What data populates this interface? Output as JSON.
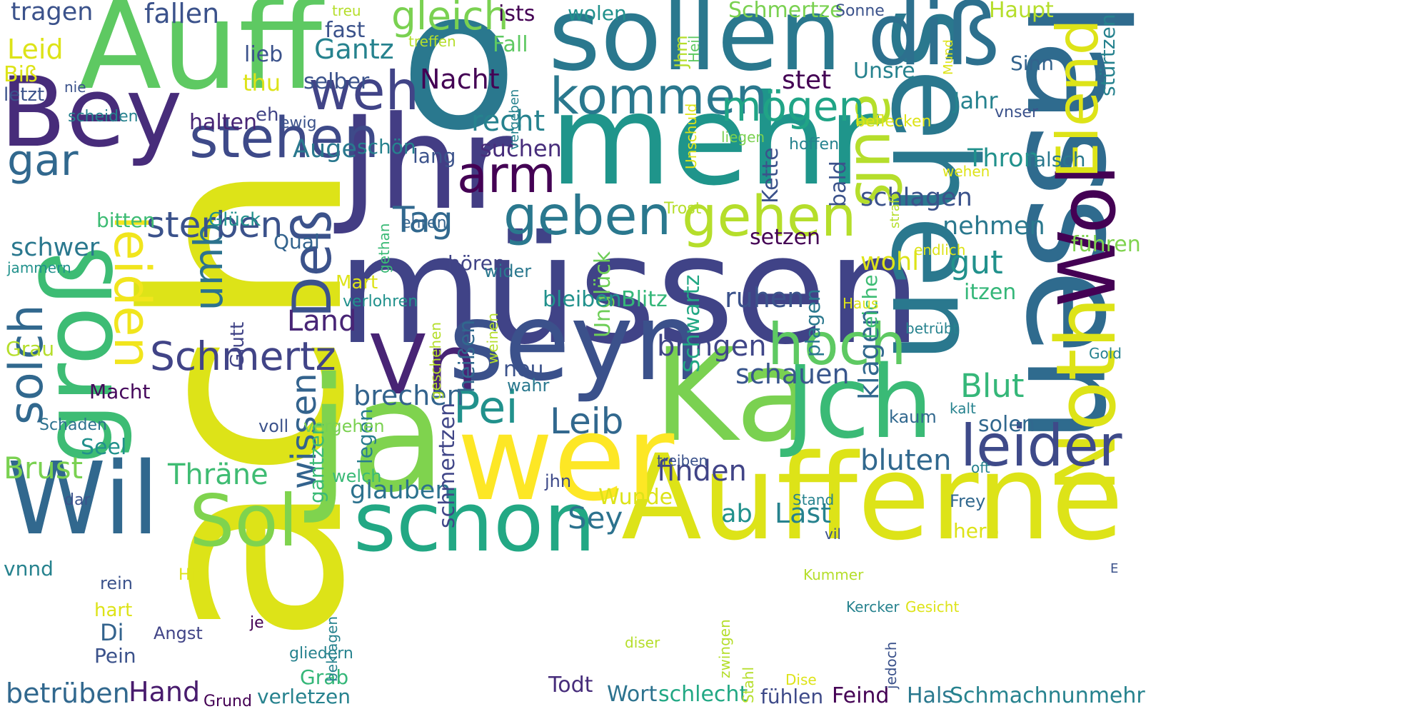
{
  "words": [
    {
      "text": "ach",
      "color": "#dde318"
    },
    {
      "text": "müssen",
      "color": "#404387"
    },
    {
      "text": "lassen",
      "color": "#2f6b8e"
    },
    {
      "text": "o",
      "color": "#2a788e"
    },
    {
      "text": "Jhr",
      "color": "#433d84"
    },
    {
      "text": "ja",
      "color": "#7fd34e"
    },
    {
      "text": "mehr",
      "color": "#1f958b"
    },
    {
      "text": "seyn",
      "color": "#3b518b"
    },
    {
      "text": "Auff",
      "color": "#5ec962"
    },
    {
      "text": "sehen",
      "color": "#2a788e"
    },
    {
      "text": "Ka",
      "color": "#7ad151"
    },
    {
      "text": "Aufferne",
      "color": "#dde318"
    },
    {
      "text": "wer",
      "color": "#fde725"
    },
    {
      "text": "sollen",
      "color": "#2a788e"
    },
    {
      "text": "groß",
      "color": "#3dbc74"
    },
    {
      "text": "Bey",
      "color": "#472c7a"
    },
    {
      "text": "Jch",
      "color": "#3aba76"
    },
    {
      "text": "Wil",
      "color": "#31688e"
    },
    {
      "text": "Noth",
      "color": "#dde318"
    },
    {
      "text": "schon",
      "color": "#22a884"
    },
    {
      "text": "diß",
      "color": "#2d708e"
    },
    {
      "text": "Wol",
      "color": "#440154"
    },
    {
      "text": "Vn",
      "color": "#482475"
    },
    {
      "text": "Sol",
      "color": "#7fd34e"
    },
    {
      "text": "leider",
      "color": "#3e4a89"
    },
    {
      "text": "auß",
      "color": "#b5de2b"
    },
    {
      "text": "Elend",
      "color": "#dde318"
    },
    {
      "text": "gehen",
      "color": "#b5de2b"
    },
    {
      "text": "hoch",
      "color": "#5ec962"
    },
    {
      "text": "geben",
      "color": "#2a788e"
    },
    {
      "text": "stehen",
      "color": "#3e4a89"
    },
    {
      "text": "kommen",
      "color": "#2a788e"
    },
    {
      "text": "weh",
      "color": "#414487"
    },
    {
      "text": "arm",
      "color": "#440154"
    },
    {
      "text": "Deß",
      "color": "#3b528b"
    },
    {
      "text": "leiden",
      "color": "#f1e51d"
    },
    {
      "text": "solch",
      "color": "#31688e"
    },
    {
      "text": "Schmertz",
      "color": "#414487"
    },
    {
      "text": "gar",
      "color": "#31688e"
    },
    {
      "text": "mögen",
      "color": "#20a486"
    },
    {
      "text": "Pei",
      "color": "#21918c"
    },
    {
      "text": "Leib",
      "color": "#31688e"
    },
    {
      "text": "wissen",
      "color": "#33638d"
    },
    {
      "text": "umb",
      "color": "#2c728e"
    },
    {
      "text": "gleich",
      "color": "#7ad151"
    },
    {
      "text": "Tag",
      "color": "#31688e"
    },
    {
      "text": "sterben",
      "color": "#3b528b"
    },
    {
      "text": "bringen",
      "color": "#404688"
    },
    {
      "text": "bluten",
      "color": "#31688e"
    },
    {
      "text": "Blut",
      "color": "#35b779"
    },
    {
      "text": "schauen",
      "color": "#39568c"
    },
    {
      "text": "Brust",
      "color": "#7ad151"
    },
    {
      "text": "Hand",
      "color": "#481b6d"
    },
    {
      "text": "betrüben",
      "color": "#31688e"
    },
    {
      "text": "finden",
      "color": "#414487"
    },
    {
      "text": "brechen",
      "color": "#33638d"
    },
    {
      "text": "Gantz",
      "color": "#26828e"
    },
    {
      "text": "recht",
      "color": "#26828e"
    },
    {
      "text": "suchen",
      "color": "#472d7b"
    },
    {
      "text": "Nacht",
      "color": "#440154"
    },
    {
      "text": "Land",
      "color": "#482576"
    },
    {
      "text": "Last",
      "color": "#26828e"
    },
    {
      "text": "Sey",
      "color": "#2c728e"
    },
    {
      "text": "Thräne",
      "color": "#3fbc73"
    },
    {
      "text": "glauben",
      "color": "#2c728e"
    },
    {
      "text": "gantzen",
      "color": "#3aba76"
    },
    {
      "text": "schmertzen",
      "color": "#404688"
    },
    {
      "text": "legen",
      "color": "#287d8e"
    },
    {
      "text": "Macht",
      "color": "#46085c"
    },
    {
      "text": "Schmertze",
      "color": "#7ad151"
    },
    {
      "text": "stet",
      "color": "#440154"
    },
    {
      "text": "Unsre",
      "color": "#26828e"
    },
    {
      "text": "nehmen",
      "color": "#2a788e"
    },
    {
      "text": "schlagen",
      "color": "#3b528b"
    },
    {
      "text": "setzen",
      "color": "#440154"
    },
    {
      "text": "wohl",
      "color": "#dde318"
    },
    {
      "text": "ruhen",
      "color": "#3b528b"
    },
    {
      "text": "gut",
      "color": "#21918c"
    },
    {
      "text": "klagen",
      "color": "#31688e"
    },
    {
      "text": "Leiche",
      "color": "#3dbc74"
    },
    {
      "text": "plagen",
      "color": "#2a788e"
    },
    {
      "text": "Schwartz",
      "color": "#22a884"
    },
    {
      "text": "Unglück",
      "color": "#6ece58"
    },
    {
      "text": "Jahr",
      "color": "#26828e"
    },
    {
      "text": "Sinn",
      "color": "#33638d"
    },
    {
      "text": "Haupt",
      "color": "#b5de2b"
    },
    {
      "text": "stürtzen",
      "color": "#26828e"
    },
    {
      "text": "Thron",
      "color": "#21918c"
    },
    {
      "text": "falsch",
      "color": "#2a788e"
    },
    {
      "text": "Kette",
      "color": "#3b528b"
    },
    {
      "text": "bald",
      "color": "#3b528b"
    },
    {
      "text": "führen",
      "color": "#7fd34e"
    },
    {
      "text": "itzen",
      "color": "#35b779"
    },
    {
      "text": "solen",
      "color": "#31688e"
    },
    {
      "text": "kaum",
      "color": "#31688e"
    },
    {
      "text": "herb",
      "color": "#dde318"
    },
    {
      "text": "Frey",
      "color": "#31688e"
    },
    {
      "text": "Hals",
      "color": "#2a788e"
    },
    {
      "text": "Schmachnunmehr",
      "color": "#26828e"
    },
    {
      "text": "Feind",
      "color": "#440154"
    },
    {
      "text": "fühlen",
      "color": "#3e4a89"
    },
    {
      "text": "Wort",
      "color": "#2c728e"
    },
    {
      "text": "schlecht",
      "color": "#22a884"
    },
    {
      "text": "Todt",
      "color": "#472d7b"
    },
    {
      "text": "Grab",
      "color": "#35b779"
    },
    {
      "text": "verletzen",
      "color": "#26828e"
    },
    {
      "text": "Grund",
      "color": "#440154"
    },
    {
      "text": "gliedern",
      "color": "#26828e"
    },
    {
      "text": "Pein",
      "color": "#3b528b"
    },
    {
      "text": "Di",
      "color": "#33638d"
    },
    {
      "text": "hart",
      "color": "#dde318"
    },
    {
      "text": "Angst",
      "color": "#414487"
    },
    {
      "text": "je",
      "color": "#440154"
    },
    {
      "text": "rein",
      "color": "#3b528b"
    },
    {
      "text": "Hir",
      "color": "#dde318"
    },
    {
      "text": "vnnd",
      "color": "#26828e"
    },
    {
      "text": "dar",
      "color": "#3b528b"
    },
    {
      "text": "welch",
      "color": "#3aba76"
    },
    {
      "text": "jhn",
      "color": "#3e4a89"
    },
    {
      "text": "Wunde",
      "color": "#dde318"
    },
    {
      "text": "ab",
      "color": "#21918c"
    },
    {
      "text": "voll",
      "color": "#3b528b"
    },
    {
      "text": "vergehen",
      "color": "#7ad151"
    },
    {
      "text": "Seel",
      "color": "#21918c"
    },
    {
      "text": "Schaden",
      "color": "#2c728e"
    },
    {
      "text": "Grau",
      "color": "#b5de2b"
    },
    {
      "text": "jammern",
      "color": "#21918c"
    },
    {
      "text": "schwer",
      "color": "#2a788e"
    },
    {
      "text": "bitten",
      "color": "#3dbc74"
    },
    {
      "text": "Glück",
      "color": "#21918c"
    },
    {
      "text": "Qual",
      "color": "#33638d"
    },
    {
      "text": "hören",
      "color": "#414487"
    },
    {
      "text": "Mart",
      "color": "#dde318"
    },
    {
      "text": "verlohren",
      "color": "#21918c"
    },
    {
      "text": "bleiben",
      "color": "#21918c"
    },
    {
      "text": "Blitz",
      "color": "#35b779"
    },
    {
      "text": "Glutt",
      "color": "#414487"
    },
    {
      "text": "heißen",
      "color": "#31688e"
    },
    {
      "text": "weinen",
      "color": "#b5de2b"
    },
    {
      "text": "geschehen",
      "color": "#b5de2b"
    },
    {
      "text": "neu",
      "color": "#3b528b"
    },
    {
      "text": "wahr",
      "color": "#2a788e"
    },
    {
      "text": "wider",
      "color": "#2a788e"
    },
    {
      "text": "gethan",
      "color": "#3aba76"
    },
    {
      "text": "ehren",
      "color": "#33638d"
    },
    {
      "text": "Auge",
      "color": "#2a788e"
    },
    {
      "text": "schön",
      "color": "#26828e"
    },
    {
      "text": "lang",
      "color": "#3b528b"
    },
    {
      "text": "halten",
      "color": "#482576"
    },
    {
      "text": "eh",
      "color": "#414487"
    },
    {
      "text": "ewig",
      "color": "#3b528b"
    },
    {
      "text": "scheiden",
      "color": "#26828e"
    },
    {
      "text": "letzt",
      "color": "#3b528b"
    },
    {
      "text": "nie",
      "color": "#3b528b"
    },
    {
      "text": "Biß",
      "color": "#dde318"
    },
    {
      "text": "Leid",
      "color": "#dde318"
    },
    {
      "text": "tragen",
      "color": "#3b528b"
    },
    {
      "text": "fallen",
      "color": "#3b528b"
    },
    {
      "text": "treu",
      "color": "#b5de2b"
    },
    {
      "text": "ists",
      "color": "#440154"
    },
    {
      "text": "wolen",
      "color": "#21918c"
    },
    {
      "text": "fast",
      "color": "#3b528b"
    },
    {
      "text": "treffen",
      "color": "#b5de2b"
    },
    {
      "text": "Fall",
      "color": "#5ec962"
    },
    {
      "text": "lieb",
      "color": "#3b528b"
    },
    {
      "text": "thu",
      "color": "#dde318"
    },
    {
      "text": "selber",
      "color": "#3b528b"
    },
    {
      "text": "Sonne",
      "color": "#3b528b"
    },
    {
      "text": "Jhm",
      "color": "#b5de2b"
    },
    {
      "text": "Heil",
      "color": "#5ec962"
    },
    {
      "text": "Mund",
      "color": "#dde318"
    },
    {
      "text": "vergeben",
      "color": "#26828e"
    },
    {
      "text": "Unschuld",
      "color": "#dde318"
    },
    {
      "text": "liegen",
      "color": "#7ad151"
    },
    {
      "text": "beflecken",
      "color": "#dde318"
    },
    {
      "text": "hoffen",
      "color": "#26828e"
    },
    {
      "text": "vnser",
      "color": "#3b528b"
    },
    {
      "text": "wehen",
      "color": "#dde318"
    },
    {
      "text": "Trost",
      "color": "#b5de2b"
    },
    {
      "text": "straff",
      "color": "#b5de2b"
    },
    {
      "text": "endlich",
      "color": "#dde318"
    },
    {
      "text": "Haus",
      "color": "#dde318"
    },
    {
      "text": "betrübt",
      "color": "#26828e"
    },
    {
      "text": "Gold",
      "color": "#26828e"
    },
    {
      "text": "kalt",
      "color": "#26828e"
    },
    {
      "text": "oft",
      "color": "#26828e"
    },
    {
      "text": "treiben",
      "color": "#3b528b"
    },
    {
      "text": "Stand",
      "color": "#26828e"
    },
    {
      "text": "vil",
      "color": "#3b528b"
    },
    {
      "text": "Kummer",
      "color": "#b5de2b"
    },
    {
      "text": "Kercker",
      "color": "#26828e"
    },
    {
      "text": "Gesicht",
      "color": "#dde318"
    },
    {
      "text": "E",
      "color": "#3b528b"
    },
    {
      "text": "diser",
      "color": "#b5de2b"
    },
    {
      "text": "zwingen",
      "color": "#b5de2b"
    },
    {
      "text": "jedoch",
      "color": "#3b528b"
    },
    {
      "text": "Dise",
      "color": "#dde318"
    },
    {
      "text": "Stahl",
      "color": "#b5de2b"
    },
    {
      "text": "beklagen",
      "color": "#26828e"
    }
  ]
}
